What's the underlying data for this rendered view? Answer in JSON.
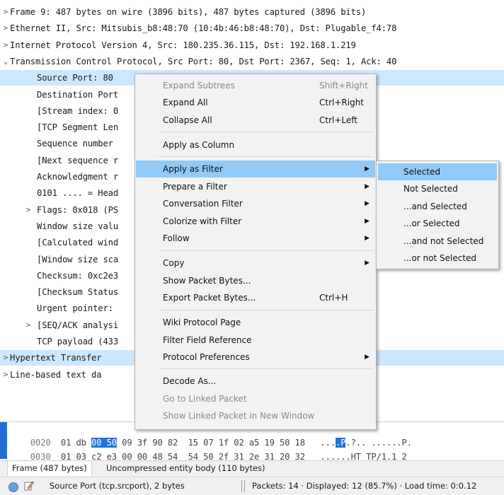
{
  "tree": {
    "rows": [
      {
        "arrow": ">",
        "text": "Frame 9: 487 bytes on wire (3896 bits), 487 bytes captured (3896 bits)"
      },
      {
        "arrow": ">",
        "text": "Ethernet II, Src: Mitsubis_b8:48:70 (10:4b:46:b8:48:70), Dst: Plugable_f4:78"
      },
      {
        "arrow": ">",
        "text": "Internet Protocol Version 4, Src: 180.235.36.115, Dst: 192.168.1.219"
      },
      {
        "arrow": "v",
        "text": "Transmission Control Protocol, Src Port: 80, Dst Port: 2367, Seq: 1, Ack: 40"
      },
      {
        "arrow": "",
        "text": "Source Port: 80"
      },
      {
        "arrow": "",
        "text": "Destination Port"
      },
      {
        "arrow": "",
        "text": "[Stream index: 0"
      },
      {
        "arrow": "",
        "text": "[TCP Segment Len"
      },
      {
        "arrow": "",
        "text": "Sequence number"
      },
      {
        "arrow": "",
        "text": "[Next sequence r                                  r)]"
      },
      {
        "arrow": "",
        "text": "Acknowledgment r"
      },
      {
        "arrow": "",
        "text": "0101 .... = Head"
      },
      {
        "arrow": ">",
        "text": "Flags: 0x018 (PS"
      },
      {
        "arrow": "",
        "text": "Window size valu"
      },
      {
        "arrow": "",
        "text": "[Calculated wind"
      },
      {
        "arrow": "",
        "text": "[Window size sca"
      },
      {
        "arrow": "",
        "text": "Checksum: 0xc2e3"
      },
      {
        "arrow": "",
        "text": "[Checksum Status"
      },
      {
        "arrow": "",
        "text": "Urgent pointer:"
      },
      {
        "arrow": ">",
        "text": "[SEQ/ACK analysi"
      },
      {
        "arrow": "",
        "text": "TCP payload (433"
      },
      {
        "arrow": ">",
        "text": "Hypertext Transfer"
      },
      {
        "arrow": ">",
        "text": "Line-based text da"
      }
    ]
  },
  "hex": {
    "row1": {
      "offset": "0020",
      "pre": "01 db ",
      "sel": "00 50",
      "post": " 09 3f 90 82  15 07 1f 02 a5 19 50 18",
      "ascii_pre": "...",
      "ascii_sel": ".P",
      "ascii_post": ".?.. ......P."
    },
    "row2": {
      "offset": "0030",
      "bytes": "01 03 c2 e3 00 00 48 54  54 50 2f 31 2e 31 20 32",
      "ascii": "......HT TP/1.1 2"
    }
  },
  "tabs": {
    "frame": "Frame (487 bytes)",
    "uncompressed": "Uncompressed entity body (110 bytes)"
  },
  "status": {
    "field": "Source Port (tcp.srcport), 2 bytes",
    "packets": "Packets: 14 · Displayed: 12 (85.7%) · Load time: 0:0.12"
  },
  "menu": {
    "expand_subtrees": "Expand Subtrees",
    "expand_subtrees_sc": "Shift+Right",
    "expand_all": "Expand All",
    "expand_all_sc": "Ctrl+Right",
    "collapse_all": "Collapse All",
    "collapse_all_sc": "Ctrl+Left",
    "apply_as_column": "Apply as Column",
    "apply_as_filter": "Apply as Filter",
    "prepare_a_filter": "Prepare a Filter",
    "conversation_filter": "Conversation Filter",
    "colorize_with_filter": "Colorize with Filter",
    "follow": "Follow",
    "copy": "Copy",
    "show_packet_bytes": "Show Packet Bytes...",
    "export_packet_bytes": "Export Packet Bytes...",
    "export_packet_bytes_sc": "Ctrl+H",
    "wiki_protocol_page": "Wiki Protocol Page",
    "filter_field_reference": "Filter Field Reference",
    "protocol_preferences": "Protocol Preferences",
    "decode_as": "Decode As...",
    "go_to_linked_packet": "Go to Linked Packet",
    "show_linked_packet": "Show Linked Packet in New Window"
  },
  "submenu": {
    "selected": "Selected",
    "not_selected": "Not Selected",
    "and_selected": "...and Selected",
    "or_selected": "...or Selected",
    "and_not_selected": "...and not Selected",
    "or_not_selected": "...or not Selected"
  },
  "colors": {
    "selection": "#cce8ff",
    "menu_highlight": "#91c9f7",
    "hex_highlight": "#1e74d9"
  }
}
